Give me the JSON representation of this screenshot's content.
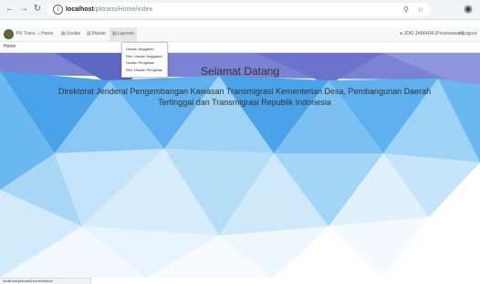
{
  "browser": {
    "url_host": "localhost",
    "url_path": "/pktrans/Home/index",
    "icons": {
      "back": "back-arrow-icon",
      "forward": "forward-arrow-icon",
      "reload": "reload-icon",
      "info": "info-icon",
      "zoom": "zoom-icon",
      "star": "star-icon",
      "profile": "profile-icon"
    }
  },
  "navbar": {
    "brand": "PK Trans",
    "items": [
      {
        "label": "Home",
        "icon": "home-icon"
      },
      {
        "label": "Usulan",
        "icon": "list-icon"
      },
      {
        "label": "Master",
        "icon": "list-icon"
      },
      {
        "label": "Laporan",
        "icon": "list-icon"
      }
    ],
    "user_label": "JOKI JAWARA (Peserwanam)",
    "logout_label": "Logout",
    "colors": {
      "navbar_bg": "#f8f8f8",
      "active_bg": "#e7e7e7"
    }
  },
  "breadcrumb": {
    "label": "Home"
  },
  "dropdown": {
    "items": [
      "Usulan Anggaran",
      "Rev. Usulan Anggaran",
      "Usulan Pengisian",
      "Rev. Usulan Pengisian"
    ]
  },
  "hero": {
    "title": "Selamat Datang",
    "subtitle": "Direktorat Jenderal Pengembangan Kawasan Transmigrasi Kementerian Desa, Pembangunan Daerah Tertinggal dan Transmigrasi Republik Indonesia",
    "colors": {
      "light": "#e8f4fd",
      "mid": "#9fd3f5",
      "deep": "#4aa3e8",
      "accent": "#6f75c9"
    }
  },
  "status_bar": {
    "text": "localhost/pktrans/Home/index#"
  }
}
